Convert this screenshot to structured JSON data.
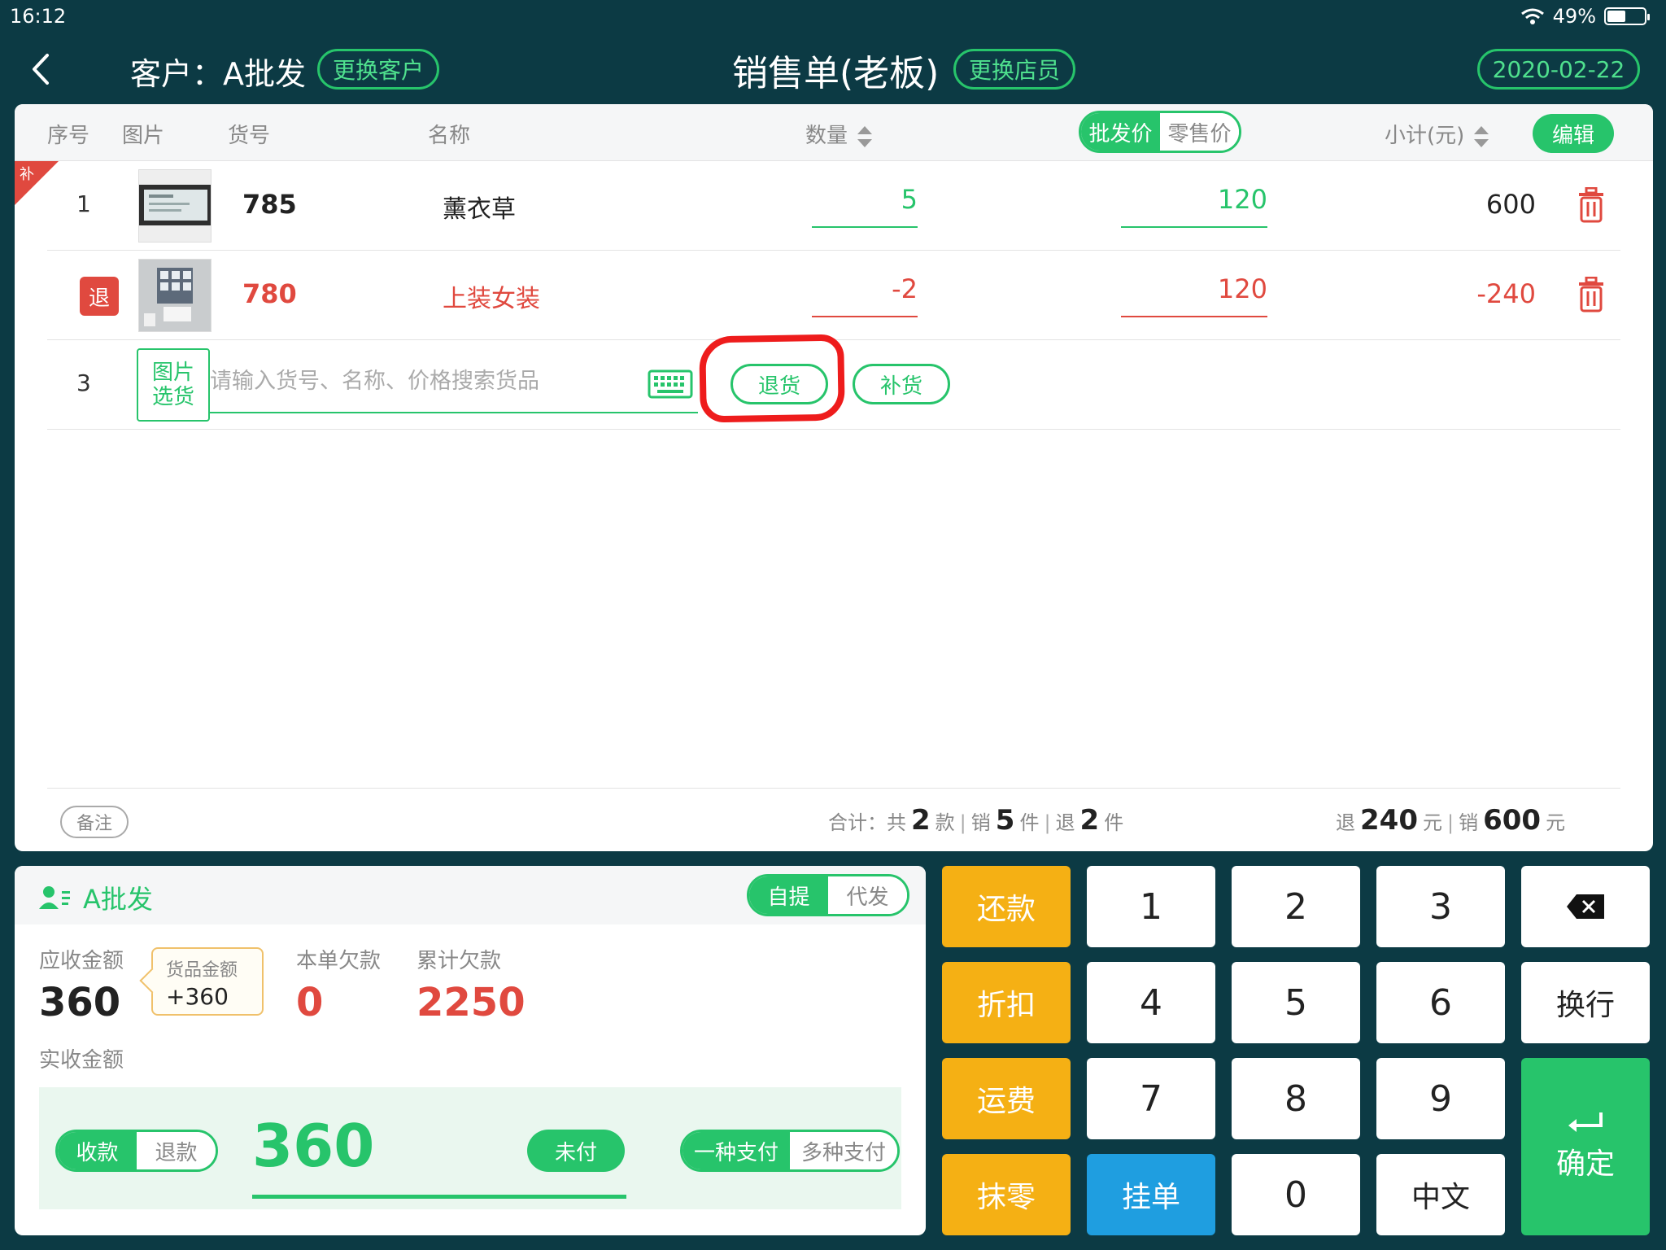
{
  "status_bar": {
    "time": "16:12",
    "battery": "49%",
    "battery_level": 0.49
  },
  "header": {
    "customer_label": "客户：A批发",
    "change_customer": "更换客户",
    "title": "销售单(老板)",
    "change_clerk": "更换店员",
    "date": "2020-02-22"
  },
  "table": {
    "headers": {
      "seq": "序号",
      "image": "图片",
      "code": "货号",
      "name": "名称",
      "qty": "数量",
      "subtotal": "小计(元)"
    },
    "price_toggle": {
      "wholesale": "批发价",
      "retail": "零售价",
      "selected": "批发价"
    },
    "edit": "编辑",
    "rows": [
      {
        "seq": "1",
        "tag": "补",
        "code": "785",
        "name": "薰衣草",
        "qty": "5",
        "price": "120",
        "subtotal": "600",
        "type": "sale"
      },
      {
        "seq": "",
        "tag": "退",
        "code": "780",
        "name": "上装女装",
        "qty": "-2",
        "price": "120",
        "subtotal": "-240",
        "type": "return"
      }
    ],
    "new_row": {
      "seq": "3",
      "pick_label_1": "图片",
      "pick_label_2": "选货",
      "search_placeholder": "请输入货号、名称、价格搜索货品",
      "return_btn": "退货",
      "restock_btn": "补货"
    }
  },
  "footer": {
    "note": "备注",
    "summary": {
      "prefix": "合计：共",
      "styles": "2",
      "styles_unit": "款",
      "sold_label": "销",
      "sold": "5",
      "sold_unit": "件",
      "returned_label": "退",
      "returned": "2",
      "returned_unit": "件"
    },
    "money": {
      "return_label": "退",
      "return_amount": "240",
      "unit": "元",
      "sale_label": "销",
      "sale_amount": "600"
    }
  },
  "payment": {
    "customer": "A批发",
    "delivery_toggle": {
      "self": "自提",
      "proxy": "代发",
      "selected": "自提"
    },
    "receivable_label": "应收金额",
    "receivable": "360",
    "goods_amount_label": "货品金额",
    "goods_amount": "+360",
    "debt_label": "本单欠款",
    "debt": "0",
    "total_debt_label": "累计欠款",
    "total_debt": "2250",
    "actual_label": "实收金额",
    "mode_toggle": {
      "collect": "收款",
      "refund": "退款",
      "selected": "收款"
    },
    "actual_amount": "360",
    "unpaid": "未付",
    "pay_method": {
      "single": "一种支付",
      "multi": "多种支付",
      "selected": "一种支付"
    }
  },
  "keypad": {
    "side": [
      "还款",
      "折扣",
      "运费",
      "抹零"
    ],
    "digits": [
      "1",
      "2",
      "3",
      "4",
      "5",
      "6",
      "7",
      "8",
      "9",
      "0"
    ],
    "hold": "挂单",
    "chinese": "中文",
    "newline": "换行",
    "confirm": "确定"
  },
  "colors": {
    "primary": "#27c46b",
    "danger": "#e0493f",
    "accent_orange": "#f5b014",
    "accent_blue": "#1f9ee0",
    "background": "#0c3a44"
  }
}
